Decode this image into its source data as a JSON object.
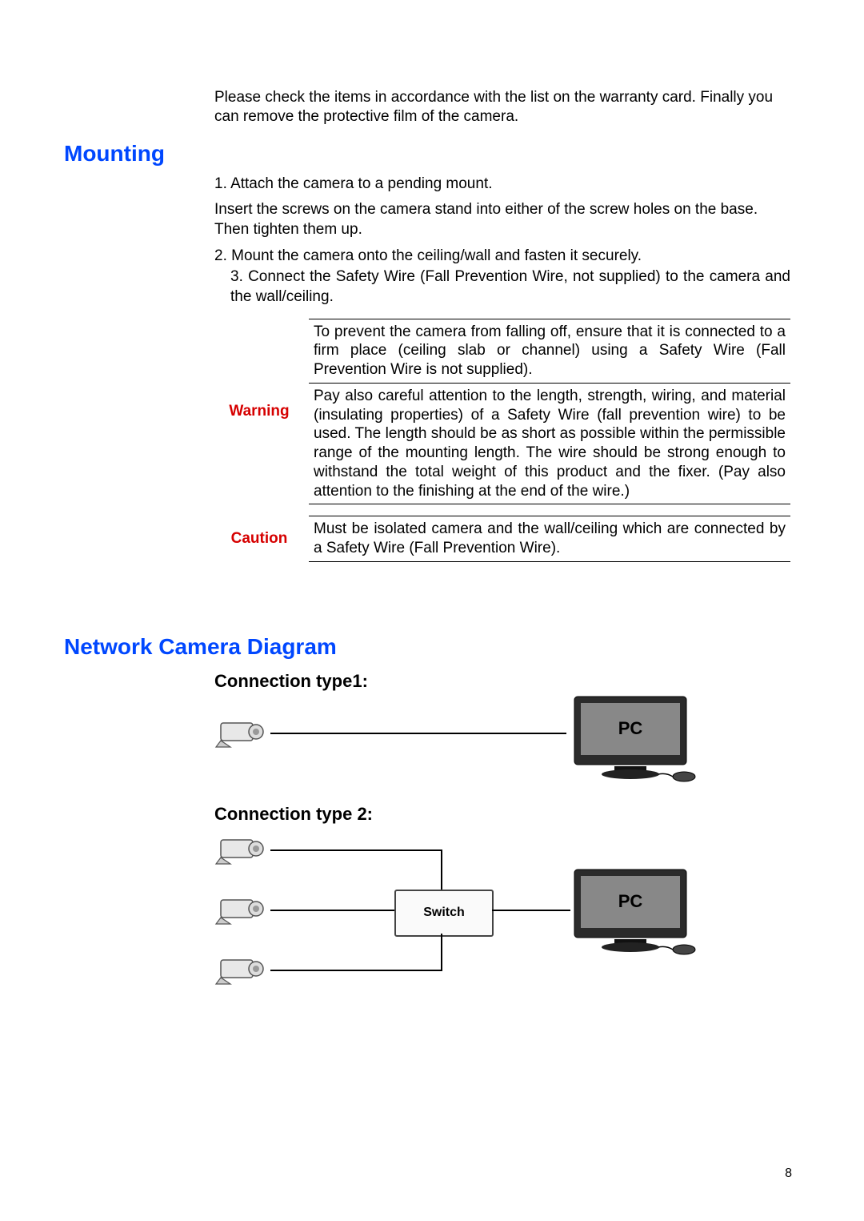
{
  "intro": "Please check the items in accordance with the list on the warranty card. Finally you can remove the protective film of the camera.",
  "mounting": {
    "heading": "Mounting",
    "step1": "1. Attach the camera to a pending mount.",
    "insert": "Insert the screws on the camera stand into either of the screw holes on the base. Then tighten them up.",
    "step2": "2. Mount the camera onto the ceiling/wall and fasten it securely.",
    "step3": "3. Connect the Safety Wire (Fall Prevention Wire, not supplied) to the camera and the wall/ceiling."
  },
  "warning": {
    "label": "Warning",
    "row1": "To prevent the camera from falling off, ensure that it is connected to a firm place (ceiling slab or channel) using a Safety Wire (Fall Prevention Wire is not supplied).",
    "row2": "Pay also careful attention to the length, strength, wiring, and material (insulating properties) of a Safety Wire (fall prevention wire) to be used. The length should be as short as possible within the permissible range of the mounting length. The wire should be strong enough to withstand the total weight of this product and the fixer. (Pay also attention to the finishing at the end of the wire.)"
  },
  "caution": {
    "label": "Caution",
    "row1": "Must be isolated camera and the wall/ceiling which are connected by a Safety Wire (Fall Prevention Wire)."
  },
  "diagram": {
    "heading": "Network Camera Diagram",
    "type1": "Connection type1:",
    "type2": "Connection type 2:",
    "switch_label": "Switch",
    "pc_label": "PC"
  },
  "page_number": "8"
}
